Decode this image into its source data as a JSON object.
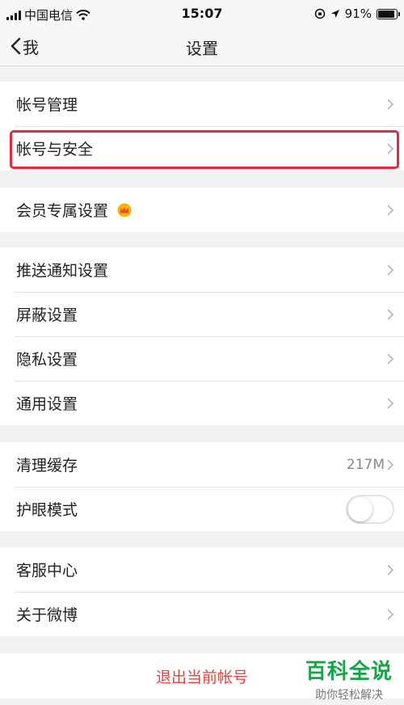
{
  "status_bar": {
    "carrier": "中国电信",
    "time": "15:07",
    "battery": "91%",
    "battery_level": 0.91
  },
  "nav": {
    "back_label": "我",
    "title": "设置"
  },
  "groups": [
    {
      "items": [
        {
          "label": "帐号管理"
        },
        {
          "label": "帐号与安全",
          "highlighted": true
        }
      ]
    },
    {
      "items": [
        {
          "label": "会员专属设置",
          "badge_icon": "crown-icon"
        }
      ]
    },
    {
      "items": [
        {
          "label": "推送通知设置"
        },
        {
          "label": "屏蔽设置"
        },
        {
          "label": "隐私设置"
        },
        {
          "label": "通用设置"
        }
      ]
    },
    {
      "items": [
        {
          "label": "清理缓存",
          "value": "217M"
        },
        {
          "label": "护眼模式",
          "toggle": false
        }
      ]
    },
    {
      "items": [
        {
          "label": "客服中心"
        },
        {
          "label": "关于微博"
        }
      ]
    }
  ],
  "logout": {
    "label": "退出当前帐号"
  },
  "watermark": {
    "main": "百科全说",
    "sub": "助你轻松解决"
  },
  "colors": {
    "highlight": "#e5283a",
    "logout": "#e0443d",
    "watermark": "#19a34a"
  }
}
